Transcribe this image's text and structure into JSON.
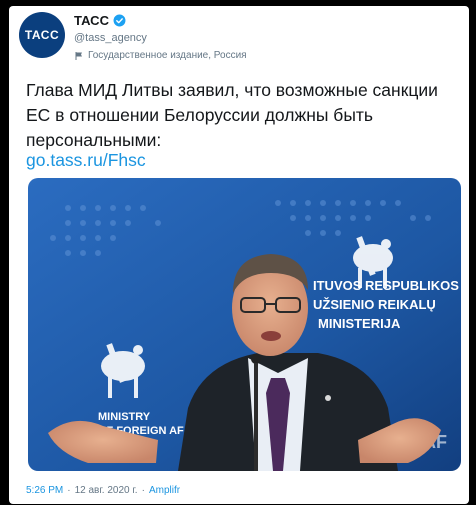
{
  "tweet": {
    "account_name": "ТАСС",
    "avatar_text": "ТАСС",
    "handle": "@tass_agency",
    "account_label": "Государственное издание, Россия",
    "text": "Глава МИД Литвы заявил, что возможные санкции ЕС в отношении Белоруссии должны быть персональными:",
    "link": "go.tass.ru/Fhsc",
    "time": "5:26 PM",
    "date": "12 авг. 2020 г.",
    "source": "Amplifr",
    "separator": "·"
  },
  "photo": {
    "backdrop_text_lines": [
      "ITUVOS RESPUBLIKOS",
      "UŽSIENIO REIKALŲ",
      "MINISTERIJA"
    ],
    "backdrop_text_left_lines": [
      "MINISTRY",
      "OF FOREIGN AF"
    ],
    "corner_mark": "AF"
  },
  "colors": {
    "link": "#1b95e0",
    "verified": "#1da1f2",
    "avatar_bg": "#0b3f7e",
    "backdrop": "#1f5aa8"
  }
}
